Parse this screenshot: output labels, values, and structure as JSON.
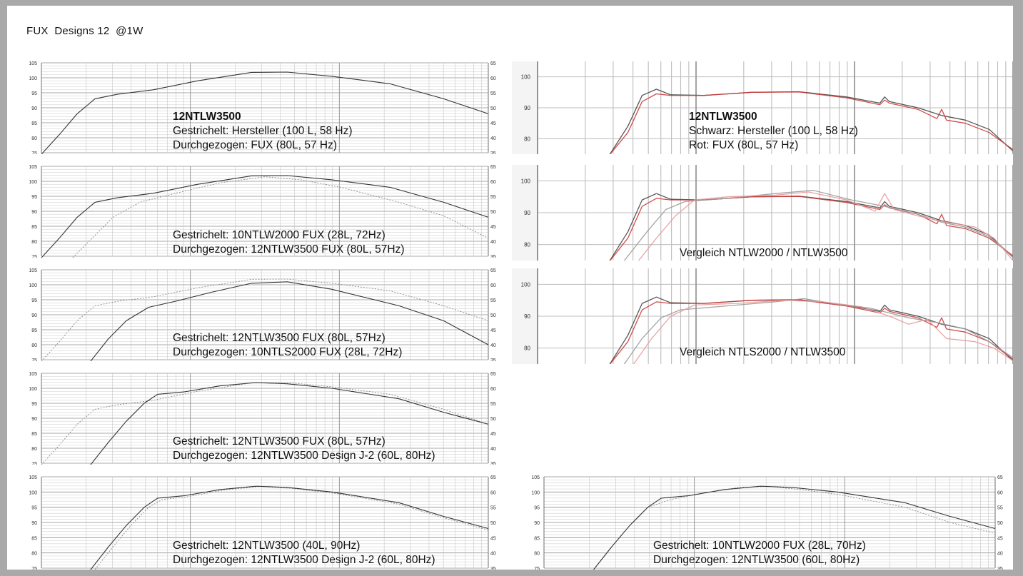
{
  "document": {
    "title": "FUX  Designs 12  @1W"
  },
  "colors": {
    "solid_line": "#333333",
    "dashed_line": "#8a8a8a",
    "red_line": "#cc3a3a",
    "dark_line": "#444444",
    "pink_line": "#e89a9a",
    "gray_line": "#9a9a9a",
    "grid": "#bdbdbd",
    "grid_dark": "#8e8e8e"
  },
  "chart_data": [
    {
      "id": "chart-l1",
      "type": "line",
      "notes": [
        "12NTLW3500",
        "Gestrichelt: Hersteller (100 L, 58 Hz)",
        "Durchgezogen: FUX (80L, 57 Hz)"
      ],
      "ylim": [
        75,
        105
      ],
      "y2lim": [
        35,
        65
      ],
      "yticks": [
        105,
        100,
        95,
        90,
        85,
        80,
        75
      ],
      "y2ticks": [
        65,
        60,
        55,
        50,
        45,
        40,
        35
      ],
      "series": [
        {
          "style": "solid",
          "x": [
            0,
            0.04,
            0.08,
            0.12,
            0.17,
            0.25,
            0.35,
            0.47,
            0.55,
            0.65,
            0.78,
            0.9,
            1
          ],
          "y": [
            74.5,
            81,
            88,
            93,
            94.5,
            96,
            99,
            101.8,
            101.9,
            100.5,
            98,
            93,
            88
          ]
        }
      ]
    },
    {
      "id": "chart-l2",
      "type": "line",
      "notes": [
        "Gestrichelt: 10NTLW2000 FUX (28L, 72Hz)",
        "Durchgezogen: 12NTLW3500 FUX (80L, 57Hz)"
      ],
      "ylim": [
        75,
        105
      ],
      "y2lim": [
        35,
        65
      ],
      "yticks": [
        105,
        100,
        95,
        90,
        85,
        80,
        75
      ],
      "y2ticks": [
        65,
        60,
        55,
        50,
        45,
        40,
        35
      ],
      "series": [
        {
          "style": "dashed",
          "x": [
            0.07,
            0.12,
            0.16,
            0.22,
            0.3,
            0.4,
            0.5,
            0.58,
            0.67,
            0.8,
            0.9,
            1
          ],
          "y": [
            74.5,
            82,
            88,
            93,
            96,
            99.5,
            101.5,
            100.5,
            98,
            93,
            88.5,
            81
          ]
        },
        {
          "style": "solid",
          "x": [
            0,
            0.04,
            0.08,
            0.12,
            0.17,
            0.25,
            0.35,
            0.47,
            0.55,
            0.65,
            0.78,
            0.9,
            1
          ],
          "y": [
            74.5,
            81,
            88,
            93,
            94.5,
            96,
            99,
            101.8,
            101.9,
            100.5,
            98,
            93,
            88
          ]
        }
      ]
    },
    {
      "id": "chart-l3",
      "type": "line",
      "notes": [
        "Gestrichelt: 12NTLW3500 FUX (80L, 57Hz)",
        "Durchgezogen: 10NTLS2000 FUX (28L, 72Hz)"
      ],
      "ylim": [
        75,
        105
      ],
      "y2lim": [
        35,
        65
      ],
      "yticks": [
        105,
        100,
        95,
        90,
        85,
        80,
        75
      ],
      "y2ticks": [
        65,
        60,
        55,
        50,
        45,
        40,
        35
      ],
      "series": [
        {
          "style": "dashed",
          "x": [
            0,
            0.04,
            0.08,
            0.12,
            0.17,
            0.25,
            0.35,
            0.47,
            0.55,
            0.65,
            0.78,
            0.9,
            1
          ],
          "y": [
            74.5,
            81,
            88,
            93,
            94.5,
            96,
            99,
            101.8,
            101.9,
            100.5,
            98,
            93,
            88
          ]
        },
        {
          "style": "solid",
          "x": [
            0.11,
            0.15,
            0.19,
            0.24,
            0.3,
            0.38,
            0.47,
            0.55,
            0.65,
            0.8,
            0.9,
            1
          ],
          "y": [
            74.5,
            82,
            88,
            92.5,
            94.5,
            97.5,
            100.5,
            101,
            98.5,
            93,
            88,
            80
          ]
        }
      ]
    },
    {
      "id": "chart-l4",
      "type": "line",
      "notes": [
        "Gestrichelt: 12NTLW3500 FUX (80L, 57Hz)",
        "Durchgezogen: 12NTLW3500 Design J-2 (60L, 80Hz)"
      ],
      "ylim": [
        75,
        105
      ],
      "y2lim": [
        35,
        65
      ],
      "yticks": [
        105,
        100,
        95,
        90,
        85,
        80,
        75
      ],
      "y2ticks": [
        65,
        60,
        55,
        50,
        45,
        40,
        35
      ],
      "series": [
        {
          "style": "dashed",
          "x": [
            0,
            0.04,
            0.08,
            0.12,
            0.17,
            0.25,
            0.35,
            0.47,
            0.55,
            0.65,
            0.78,
            0.9,
            1
          ],
          "y": [
            74.5,
            81,
            88,
            93,
            94.5,
            96,
            99,
            101.8,
            101.9,
            100.5,
            98,
            93,
            88
          ]
        },
        {
          "style": "solid",
          "x": [
            0.11,
            0.15,
            0.19,
            0.23,
            0.26,
            0.32,
            0.4,
            0.48,
            0.55,
            0.65,
            0.8,
            0.9,
            1
          ],
          "y": [
            74.5,
            82,
            89,
            95,
            98,
            98.8,
            100.8,
            101.9,
            101.5,
            100,
            96.5,
            92,
            88
          ]
        }
      ]
    },
    {
      "id": "chart-l5",
      "type": "line",
      "notes": [
        "Gestrichelt: 12NTLW3500 (40L, 90Hz)",
        "Durchgezogen: 12NTLW3500 Design J-2 (60L, 80Hz)"
      ],
      "ylim": [
        75,
        105
      ],
      "y2lim": [
        35,
        65
      ],
      "yticks": [
        105,
        100,
        95,
        90,
        85,
        80,
        75
      ],
      "y2ticks": [
        65,
        60,
        55,
        50,
        45,
        40,
        35
      ],
      "series": [
        {
          "style": "dashed",
          "x": [
            0.12,
            0.16,
            0.2,
            0.24,
            0.27,
            0.33,
            0.41,
            0.49,
            0.56,
            0.66,
            0.8,
            0.9,
            1
          ],
          "y": [
            74.5,
            82,
            89,
            95,
            97.5,
            98.5,
            100.7,
            101.8,
            101.2,
            99.5,
            96,
            91.5,
            87.5
          ]
        },
        {
          "style": "solid",
          "x": [
            0.11,
            0.15,
            0.19,
            0.23,
            0.26,
            0.32,
            0.4,
            0.48,
            0.55,
            0.65,
            0.8,
            0.9,
            1
          ],
          "y": [
            74.5,
            82,
            89,
            95,
            98,
            98.8,
            100.8,
            101.9,
            101.5,
            100,
            96.5,
            92,
            88
          ]
        }
      ]
    },
    {
      "id": "chart-r1",
      "type": "line",
      "notes": [
        "12NTLW3500",
        "Schwarz: Hersteller (100 L, 58 Hz)",
        "Rot: FUX (80L, 57 Hz)"
      ],
      "ylim": [
        75,
        105
      ],
      "yticks": [
        100,
        90,
        80
      ],
      "series": [
        {
          "style": "dark",
          "x": [
            0.15,
            0.19,
            0.22,
            0.25,
            0.28,
            0.35,
            0.45,
            0.55,
            0.65,
            0.72,
            0.73,
            0.74,
            0.8,
            0.85,
            0.9,
            0.95,
            1
          ],
          "y": [
            74.5,
            84,
            94,
            96,
            94.2,
            94,
            95,
            95.2,
            93.5,
            91.5,
            93.5,
            92,
            90,
            87.5,
            86,
            83,
            76
          ]
        },
        {
          "style": "red",
          "x": [
            0.15,
            0.19,
            0.22,
            0.25,
            0.28,
            0.35,
            0.45,
            0.55,
            0.65,
            0.72,
            0.73,
            0.74,
            0.8,
            0.84,
            0.85,
            0.86,
            0.9,
            0.95,
            1
          ],
          "y": [
            74.5,
            82,
            92,
            94.5,
            94,
            94,
            95,
            95.1,
            93.2,
            91,
            92.5,
            91.5,
            89.5,
            86.5,
            89.5,
            86,
            85,
            82,
            76.5
          ]
        }
      ]
    },
    {
      "id": "chart-r2",
      "type": "line",
      "notes": [
        "Vergleich NTLW2000 / NTLW3500"
      ],
      "ylim": [
        75,
        105
      ],
      "yticks": [
        100,
        90,
        80
      ],
      "series": [
        {
          "style": "dark",
          "x": [
            0.15,
            0.19,
            0.22,
            0.25,
            0.28,
            0.35,
            0.45,
            0.55,
            0.65,
            0.72,
            0.73,
            0.74,
            0.8,
            0.85,
            0.9,
            0.95,
            1
          ],
          "y": [
            74.5,
            84,
            94,
            96,
            94.2,
            94,
            95,
            95.2,
            93.5,
            91.5,
            93.5,
            92,
            90,
            87.5,
            86,
            83,
            76
          ]
        },
        {
          "style": "red",
          "x": [
            0.15,
            0.19,
            0.22,
            0.25,
            0.28,
            0.35,
            0.45,
            0.55,
            0.65,
            0.72,
            0.73,
            0.74,
            0.8,
            0.84,
            0.85,
            0.86,
            0.9,
            0.95,
            1
          ],
          "y": [
            74.5,
            82,
            92,
            94.5,
            94,
            94,
            95,
            95.1,
            93.2,
            91,
            92.5,
            91.5,
            89.5,
            86.5,
            89.5,
            86,
            85,
            82,
            76.5
          ]
        },
        {
          "style": "gray",
          "x": [
            0.18,
            0.23,
            0.27,
            0.31,
            0.4,
            0.5,
            0.58,
            0.66,
            0.73,
            0.8,
            0.85,
            0.9,
            0.95,
            1
          ],
          "y": [
            74.5,
            84,
            91,
            93.5,
            94.5,
            96,
            97,
            94,
            92,
            89.5,
            87,
            85.5,
            82.5,
            76
          ]
        },
        {
          "style": "pink",
          "x": [
            0.21,
            0.25,
            0.29,
            0.33,
            0.4,
            0.5,
            0.57,
            0.65,
            0.71,
            0.73,
            0.75,
            0.8,
            0.86,
            0.92,
            0.96,
            1
          ],
          "y": [
            74.5,
            82,
            89,
            94,
            95,
            95.5,
            96.5,
            94,
            90.5,
            96,
            91,
            89,
            87,
            85.5,
            82,
            75
          ]
        }
      ]
    },
    {
      "id": "chart-r3",
      "type": "line",
      "notes": [
        "Vergleich NTLS2000 / NTLW3500"
      ],
      "ylim": [
        75,
        105
      ],
      "yticks": [
        100,
        90,
        80
      ],
      "series": [
        {
          "style": "dark",
          "x": [
            0.15,
            0.19,
            0.22,
            0.25,
            0.28,
            0.35,
            0.45,
            0.55,
            0.65,
            0.72,
            0.73,
            0.74,
            0.8,
            0.85,
            0.9,
            0.95,
            1
          ],
          "y": [
            74.5,
            84,
            94,
            96,
            94.2,
            94,
            95,
            95.2,
            93.5,
            91.5,
            93.5,
            92,
            90,
            87.5,
            86,
            83,
            76
          ]
        },
        {
          "style": "red",
          "x": [
            0.15,
            0.19,
            0.22,
            0.25,
            0.28,
            0.35,
            0.45,
            0.55,
            0.65,
            0.72,
            0.73,
            0.74,
            0.8,
            0.84,
            0.85,
            0.86,
            0.9,
            0.95,
            1
          ],
          "y": [
            74.5,
            82,
            92,
            94.5,
            94,
            94,
            95,
            95.1,
            93.2,
            91,
            92.5,
            91.5,
            89.5,
            86.5,
            89.5,
            86,
            85,
            82,
            76.5
          ]
        },
        {
          "style": "gray",
          "x": [
            0.18,
            0.22,
            0.26,
            0.3,
            0.38,
            0.5,
            0.56,
            0.62,
            0.7,
            0.78,
            0.84,
            0.9,
            0.95,
            1
          ],
          "y": [
            74.5,
            83,
            89.5,
            92,
            93,
            94.5,
            95.5,
            94,
            92.5,
            89.5,
            88,
            86,
            82,
            77
          ]
        },
        {
          "style": "pink",
          "x": [
            0.2,
            0.24,
            0.28,
            0.33,
            0.42,
            0.52,
            0.6,
            0.68,
            0.74,
            0.78,
            0.82,
            0.86,
            0.92,
            0.96,
            1
          ],
          "y": [
            74.5,
            83,
            90,
            93.5,
            94,
            95,
            94.5,
            93,
            90,
            87.5,
            89,
            83,
            82,
            80,
            76
          ]
        }
      ]
    },
    {
      "id": "chart-r4",
      "type": "line",
      "notes": [
        "Gestrichelt: 10NTLW2000 FUX (28L, 70Hz)",
        "Durchgezogen: 12NTLW3500 (60L, 80Hz)"
      ],
      "ylim": [
        75,
        105
      ],
      "y2lim": [
        25,
        65
      ],
      "yticks": [
        105,
        100,
        95,
        90,
        85,
        80,
        75
      ],
      "y2ticks": [
        65,
        60,
        55,
        50,
        45,
        40,
        35
      ],
      "series": [
        {
          "style": "dashed",
          "x": [
            0.11,
            0.15,
            0.19,
            0.23,
            0.28,
            0.35,
            0.43,
            0.5,
            0.57,
            0.66,
            0.8,
            0.9,
            1
          ],
          "y": [
            74.5,
            82,
            89,
            95,
            97.5,
            99.5,
            101.5,
            101.8,
            100.8,
            99,
            95,
            90,
            86.5
          ]
        },
        {
          "style": "solid",
          "x": [
            0.11,
            0.15,
            0.19,
            0.23,
            0.26,
            0.32,
            0.4,
            0.48,
            0.55,
            0.65,
            0.8,
            0.9,
            1
          ],
          "y": [
            74.5,
            82,
            89,
            95,
            98,
            98.8,
            100.8,
            101.9,
            101.5,
            100,
            96.5,
            92,
            88
          ]
        }
      ]
    }
  ]
}
